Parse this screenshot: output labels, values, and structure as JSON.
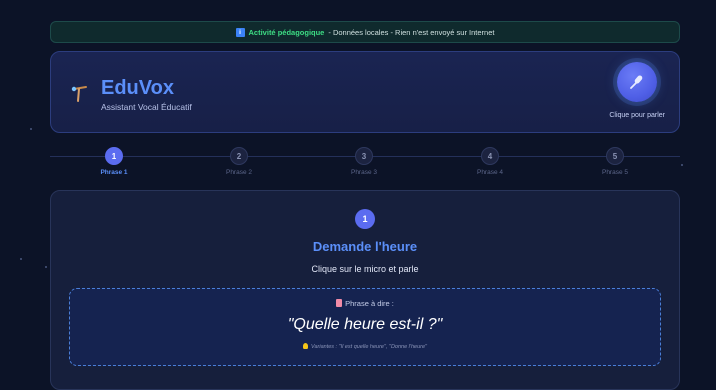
{
  "banner": {
    "icon": "info-icon",
    "strong": "Activité pédagogique",
    "rest": " - Données locales - Rien n'est envoyé sur Internet"
  },
  "header": {
    "title": "EduVox",
    "subtitle": "Assistant Vocal Éducatif",
    "mic_label": "Clique pour parler",
    "logo_icon": "pointer-tool-icon",
    "mic_icon": "microphone-icon"
  },
  "steps": [
    {
      "number": "1",
      "label": "Phrase 1",
      "active": true
    },
    {
      "number": "2",
      "label": "Phrase 2",
      "active": false
    },
    {
      "number": "3",
      "label": "Phrase 3",
      "active": false
    },
    {
      "number": "4",
      "label": "Phrase 4",
      "active": false
    },
    {
      "number": "5",
      "label": "Phrase 5",
      "active": false
    }
  ],
  "task": {
    "number": "1",
    "title": "Demande l'heure",
    "instruction": "Clique sur le micro et parle",
    "phrase_heading": "Phrase à dire :",
    "phrase": "\"Quelle heure est-il ?\"",
    "variants": "Variantes : \"Il est quelle heure\", \"Donne l'heure\""
  },
  "colors": {
    "accent": "#5b8ff9",
    "active_step": "#5b6cf0",
    "banner_highlight": "#3ddc84",
    "background": "#0c1327"
  }
}
